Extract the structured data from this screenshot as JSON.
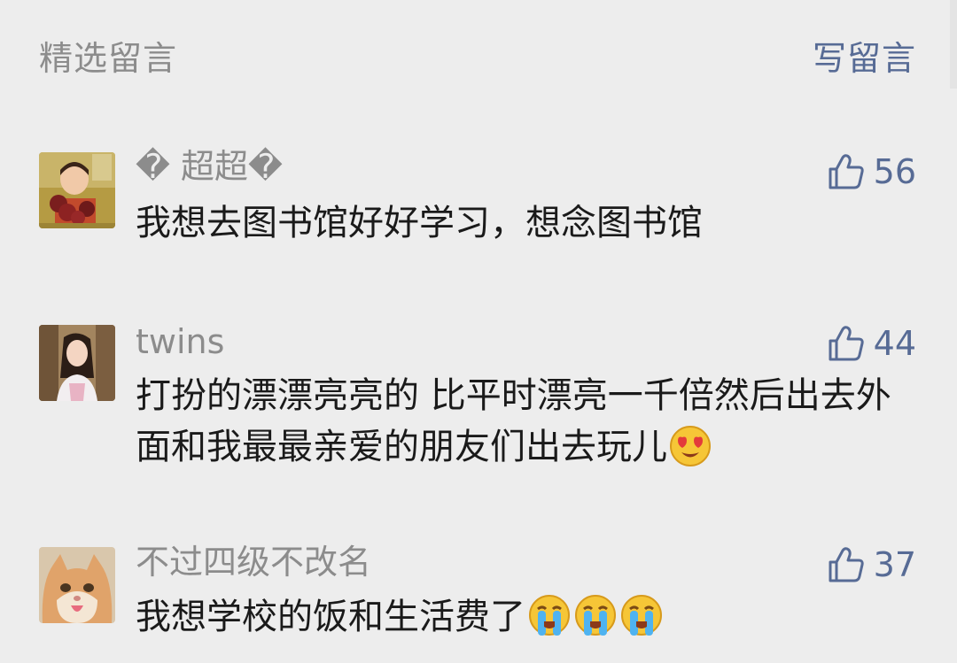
{
  "header": {
    "title": "精选留言",
    "write_label": "写留言"
  },
  "colors": {
    "background": "#ededed",
    "nickname": "#8c8c8c",
    "link": "#576b95",
    "text": "#1a1a1a"
  },
  "comments": [
    {
      "nickname": "� 超超�",
      "likes": "56",
      "text": "我想去图书馆好好学习，想念图书馆",
      "emojis": []
    },
    {
      "nickname": "twins",
      "likes": "44",
      "text": "打扮的漂漂亮亮的 比平时漂亮一千倍然后出去外面和我最最亲爱的朋友们出去玩儿",
      "emojis": [
        "heart-eyes-emoji"
      ]
    },
    {
      "nickname": "不过四级不改名",
      "likes": "37",
      "text": "我想学校的饭和生活费了",
      "emojis": [
        "crying-emoji",
        "crying-emoji",
        "crying-emoji"
      ]
    }
  ]
}
